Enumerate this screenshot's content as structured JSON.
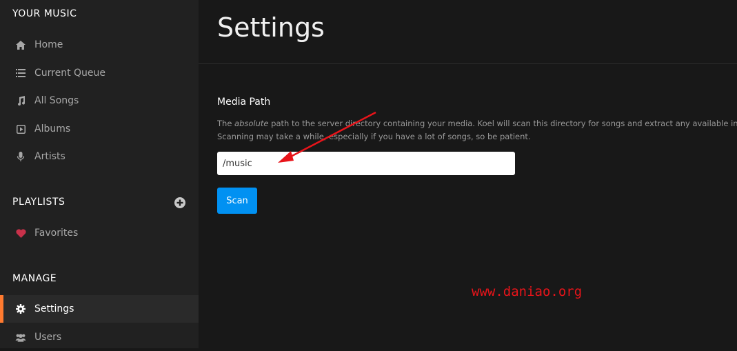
{
  "sidebar": {
    "your_music_title": "YOUR MUSIC",
    "items": [
      {
        "label": "Home",
        "icon": "home-icon"
      },
      {
        "label": "Current Queue",
        "icon": "queue-icon"
      },
      {
        "label": "All Songs",
        "icon": "music-note-icon"
      },
      {
        "label": "Albums",
        "icon": "album-icon"
      },
      {
        "label": "Artists",
        "icon": "microphone-icon"
      }
    ],
    "playlists_title": "PLAYLISTS",
    "playlists": [
      {
        "label": "Favorites",
        "icon": "heart-icon"
      }
    ],
    "manage_title": "MANAGE",
    "manage_items": [
      {
        "label": "Settings",
        "icon": "gear-icon",
        "active": true
      },
      {
        "label": "Users",
        "icon": "users-icon"
      }
    ]
  },
  "main": {
    "title": "Settings",
    "media_path": {
      "label": "Media Path",
      "help_prefix": "The ",
      "help_emphasis": "absolute",
      "help_line1_rest": " path to the server directory containing your media. Koel will scan this directory for songs and extract any available informatio",
      "help_line2": "Scanning may take a while, especially if you have a lot of songs, so be patient.",
      "value": "/music"
    },
    "scan_label": "Scan"
  },
  "watermark": "www.daniao.org",
  "colors": {
    "sidebar_bg": "#212121",
    "main_bg": "#181818",
    "active_accent": "#ff7a2f",
    "button_blue": "#0191f2",
    "favorite_heart": "#c8314a",
    "annotation_red": "#e8141a"
  }
}
